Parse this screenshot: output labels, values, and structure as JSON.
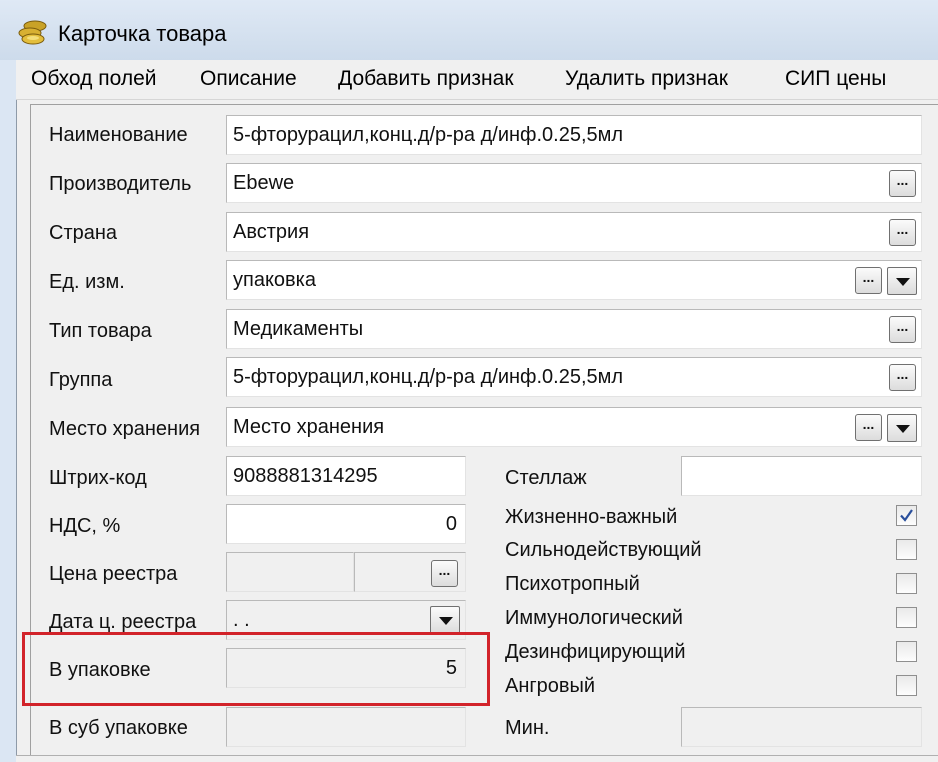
{
  "window": {
    "title": "Карточка товара",
    "icon": "coins-icon"
  },
  "menu": [
    "Обход полей",
    "Описание",
    "Добавить признак",
    "Удалить  признак",
    "СИП цены"
  ],
  "fields": {
    "name": {
      "label": "Наименование",
      "value": "5-фторурацил,конц.д/р-ра д/инф.0.25,5мл"
    },
    "manufacturer": {
      "label": "Производитель",
      "value": "Ebewe"
    },
    "country": {
      "label": "Страна",
      "value": "Австрия"
    },
    "unit": {
      "label": "Ед. изм.",
      "value": "упаковка"
    },
    "product_type": {
      "label": "Тип товара",
      "value": "Медикаменты"
    },
    "group": {
      "label": "Группа",
      "value": "5-фторурацил,конц.д/р-ра д/инф.0.25,5мл"
    },
    "storage": {
      "label": "Место хранения",
      "value": "Место хранения"
    },
    "barcode": {
      "label": "Штрих-код",
      "value": "9088881314295"
    },
    "vat": {
      "label": "НДС, %",
      "value": "0"
    },
    "registry_price": {
      "label": "Цена реестра",
      "value": ""
    },
    "registry_date": {
      "label": "Дата ц. реестра",
      "value": ". ."
    },
    "in_package": {
      "label": "В упаковке",
      "value": "5"
    },
    "in_subpackage": {
      "label": "В суб упаковке",
      "value": ""
    },
    "rack": {
      "label": "Стеллаж",
      "value": ""
    },
    "min": {
      "label": "Мин.",
      "value": ""
    }
  },
  "flags": [
    {
      "label": "Жизненно-важный",
      "checked": true
    },
    {
      "label": "Сильнодействующий",
      "checked": false
    },
    {
      "label": "Психотропный",
      "checked": false
    },
    {
      "label": "Иммунологический",
      "checked": false
    },
    {
      "label": "Дезинфицирующий",
      "checked": false
    },
    {
      "label": "Ангровый",
      "checked": false
    }
  ],
  "ellipsis": "...",
  "colors": {
    "highlight": "#d2232a",
    "check": "#2a4f9c"
  }
}
